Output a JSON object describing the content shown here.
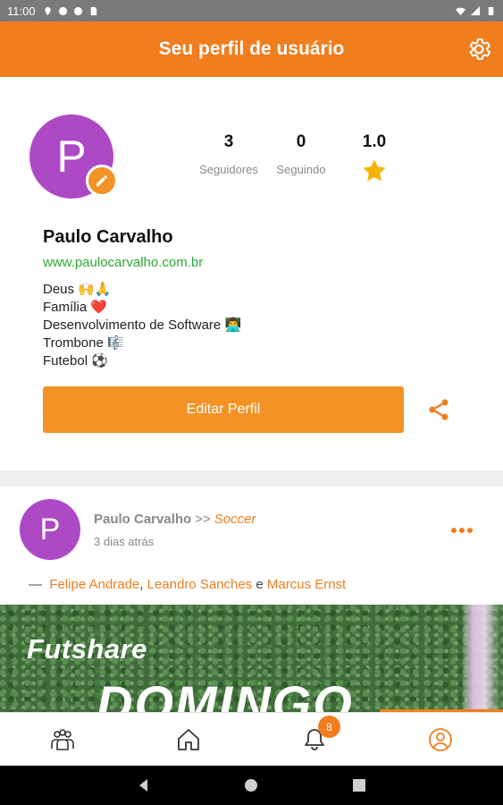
{
  "status_bar": {
    "time": "11:00"
  },
  "app_bar": {
    "title": "Seu perfil de usuário"
  },
  "profile": {
    "avatar_letter": "P",
    "stats": [
      {
        "value": "3",
        "label": "Seguidores"
      },
      {
        "value": "0",
        "label": "Seguindo"
      },
      {
        "value": "1.0"
      }
    ],
    "name": "Paulo Carvalho",
    "website": "www.paulocarvalho.com.br",
    "bio": [
      "Deus 🙌🙏",
      "Família ❤️",
      "Desenvolvimento de Software 👨‍💻",
      "Trombone 🎼",
      "Futebol ⚽"
    ],
    "edit_button": "Editar Perfil"
  },
  "post": {
    "avatar_letter": "P",
    "author": "Paulo Carvalho",
    "separator": ">>",
    "group": "Soccer",
    "time": "3 dias atrás",
    "tag_prefix": "—",
    "tags": [
      "Felipe Andrade",
      "Leandro Sanches",
      "Marcus Ernst"
    ],
    "tag_comma": ",",
    "tag_and": "e",
    "image_text": {
      "brand": "Futshare",
      "headline": "DOMINGO"
    }
  },
  "bottom_nav": {
    "items": [
      "groups-icon",
      "home-icon",
      "bell-icon",
      "profile-icon"
    ],
    "active": "profile-icon",
    "notification_count": "8"
  },
  "colors": {
    "primary": "#f07d1e",
    "button": "#f39325",
    "avatar": "#ad49c4",
    "link": "#2eaa36",
    "star": "#f4b400"
  }
}
